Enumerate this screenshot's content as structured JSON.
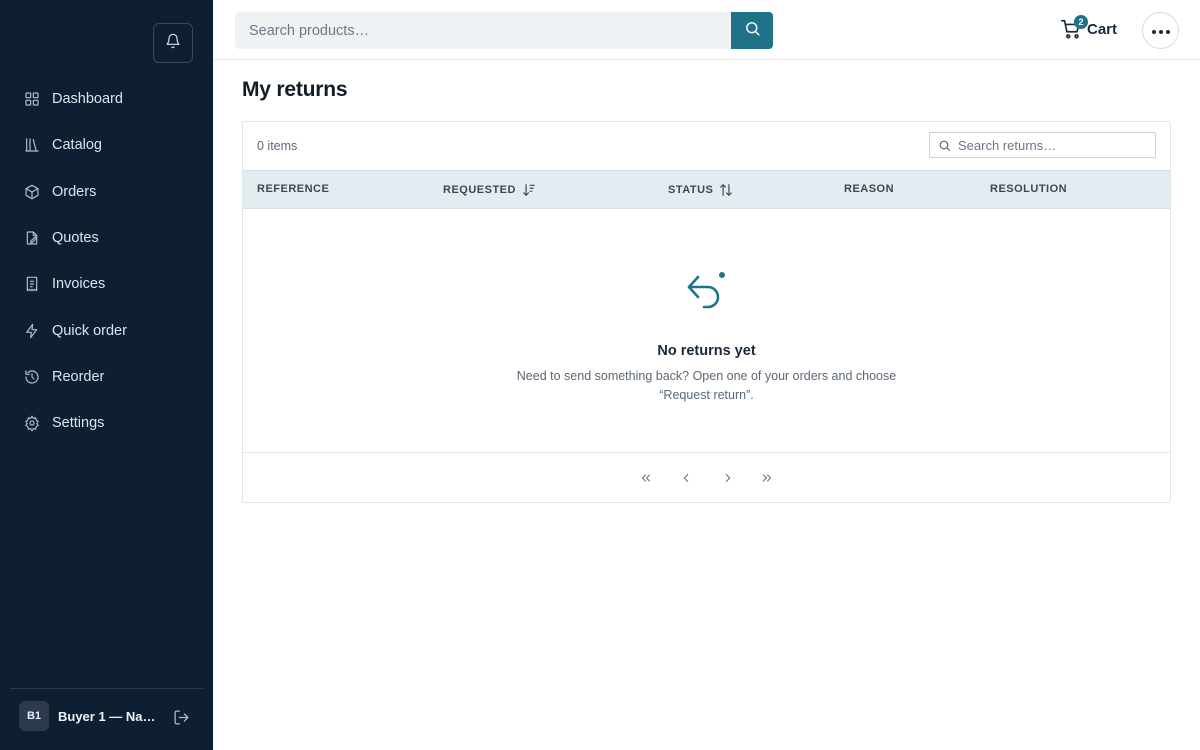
{
  "colors": {
    "sidebar_bg": "#0e1f33",
    "accent": "#1f7389",
    "table_header_bg": "#e3edf1"
  },
  "sidebar": {
    "notification_icon": "bell-icon",
    "items": [
      {
        "label": "Dashboard",
        "icon": "dashboard-grid-icon"
      },
      {
        "label": "Catalog",
        "icon": "catalog-books-icon"
      },
      {
        "label": "Orders",
        "icon": "box-icon"
      },
      {
        "label": "Quotes",
        "icon": "quote-document-icon"
      },
      {
        "label": "Invoices",
        "icon": "receipt-icon"
      },
      {
        "label": "Quick order",
        "icon": "lightning-icon"
      },
      {
        "label": "Reorder",
        "icon": "history-icon"
      },
      {
        "label": "Settings",
        "icon": "gear-icon"
      }
    ],
    "user": {
      "initials": "B1",
      "name": "Buyer 1 — Nair…",
      "logout_icon": "logout-icon"
    }
  },
  "header": {
    "search_placeholder": "Search products…",
    "search_icon": "search-icon",
    "cart_label": "Cart",
    "cart_count": "2",
    "more_icon": "more-horizontal-icon"
  },
  "main": {
    "title": "My returns",
    "items_count": "0 items",
    "returns_search_placeholder": "Search returns…",
    "columns": [
      {
        "label": "REFERENCE",
        "sort": "none"
      },
      {
        "label": "REQUESTED",
        "sort": "descending"
      },
      {
        "label": "STATUS",
        "sort": "sortable"
      },
      {
        "label": "REASON",
        "sort": "none"
      },
      {
        "label": "RESOLUTION",
        "sort": "none"
      }
    ],
    "rows": [],
    "empty_state": {
      "icon": "return-arrow-icon",
      "title": "No returns yet",
      "message": "Need to send something back? Open one of your orders and choose “Request return”."
    },
    "pagination": {
      "first_icon": "chevrons-left-icon",
      "prev_icon": "chevron-left-icon",
      "next_icon": "chevron-right-icon",
      "last_icon": "chevrons-right-icon"
    }
  }
}
